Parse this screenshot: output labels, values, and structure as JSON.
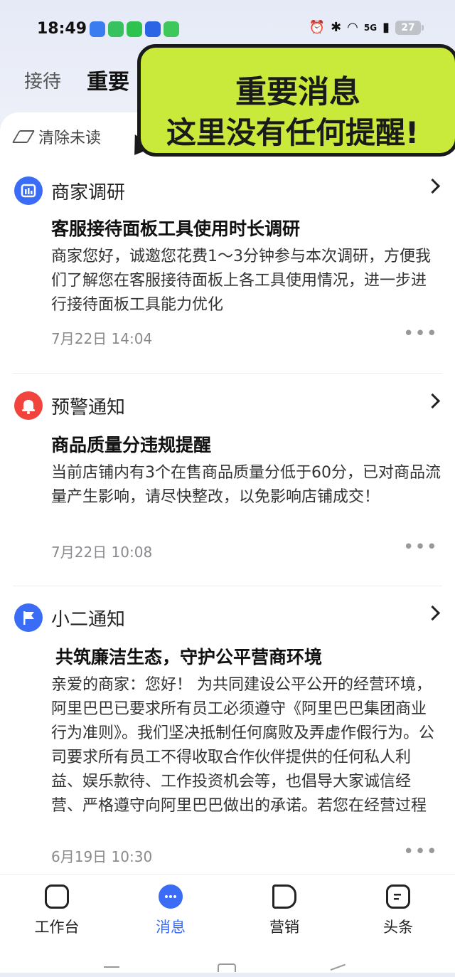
{
  "status_bar": {
    "time": "18:49",
    "signal": "5G",
    "battery": "27"
  },
  "tabs": {
    "reception": "接待",
    "important": "重要"
  },
  "overlay": {
    "line1": "重要消息",
    "line2": "这里没有任何提醒!"
  },
  "clear_unread": "清除未读",
  "messages": [
    {
      "category": "商家调研",
      "title": "客服接待面板工具使用时长调研",
      "body": "商家您好，诚邀您花费1～3分钟参与本次调研，方便我们了解您在客服接待面板上各工具使用情况，进一步进行接待面板工具能力优化",
      "time": "7月22日 14:04",
      "icon": "chart-icon",
      "color": "#3b6cf6"
    },
    {
      "category": "预警通知",
      "title": "商品质量分违规提醒",
      "body": "当前店铺内有3个在售商品质量分低于60分，已对商品流量产生影响，请尽快整改，以免影响店铺成交！",
      "time": "7月22日 10:08",
      "icon": "bell-icon",
      "color": "#f0443c"
    },
    {
      "category": "小二通知",
      "title": "共筑廉洁生态，守护公平营商环境",
      "body": "亲爱的商家：您好！ 为共同建设公平公开的经营环境，阿里巴巴已要求所有员工必须遵守《阿里巴巴集团商业行为准则》。我们坚决抵制任何腐败及弄虚作假行为。公司要求所有员工不得收取合作伙伴提供的任何私人利益、娱乐款待、工作投资机会等，也倡导大家诚信经营、严格遵守向阿里巴巴做出的承诺。若您在经营过程中发现我们的员工有违反上述要求...",
      "time": "6月19日 10:30",
      "icon": "flag-icon",
      "color": "#3b6cf6"
    }
  ],
  "more": "•••",
  "bottom_nav": [
    {
      "label": "工作台",
      "icon": "workbench-icon"
    },
    {
      "label": "消息",
      "icon": "message-icon",
      "active": true
    },
    {
      "label": "营销",
      "icon": "megaphone-icon"
    },
    {
      "label": "头条",
      "icon": "news-icon"
    }
  ]
}
